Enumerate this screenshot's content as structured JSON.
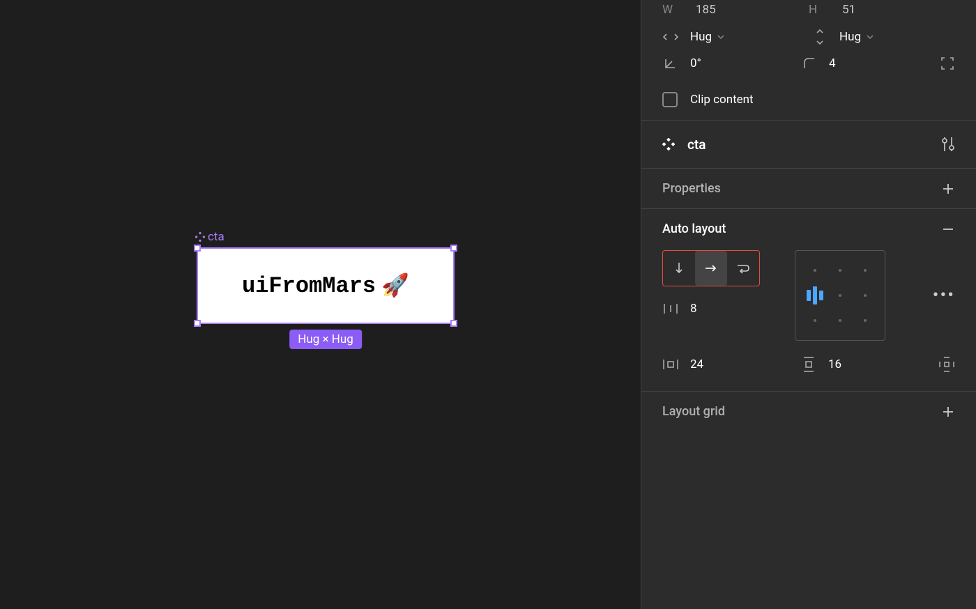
{
  "canvas": {
    "component_label": "cta",
    "frame_text": "uiFromMars",
    "frame_emoji": "🚀",
    "size_badge": "Hug × Hug"
  },
  "panel": {
    "dimensions": {
      "w_label": "W",
      "w_value": "185",
      "h_label": "H",
      "h_value": "51"
    },
    "sizing": {
      "horizontal": "Hug",
      "vertical": "Hug"
    },
    "rotation": {
      "value": "0°"
    },
    "corner_radius": {
      "value": "4"
    },
    "clip_content_label": "Clip content",
    "component": {
      "name": "cta"
    },
    "properties": {
      "title": "Properties"
    },
    "autolayout": {
      "title": "Auto layout",
      "item_spacing": "8",
      "horizontal_padding": "24",
      "vertical_padding": "16"
    },
    "layout_grid": {
      "title": "Layout grid"
    }
  }
}
